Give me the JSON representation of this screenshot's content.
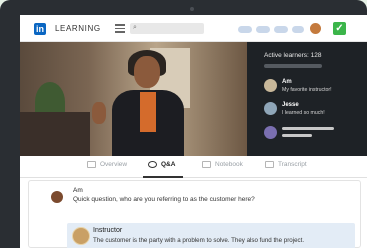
{
  "header": {
    "logo": "in",
    "brand": "LEARNING",
    "search_icon": "search-icon",
    "colors": {
      "brand": "#0a66c2",
      "check": "#3bb54a"
    }
  },
  "video": {
    "progress_fraction": 0.46
  },
  "sidebar": {
    "active_learners": "Active learners: 128",
    "messages": [
      {
        "name": "Am",
        "text": "My favorite instructor!"
      },
      {
        "name": "Jesse",
        "text": "I learned so much!"
      }
    ]
  },
  "tabs": [
    {
      "label": "Overview",
      "icon": "document-icon",
      "active": false
    },
    {
      "label": "Q&A",
      "icon": "chat-icon",
      "active": true
    },
    {
      "label": "Notebook",
      "icon": "notebook-icon",
      "active": false
    },
    {
      "label": "Transcript",
      "icon": "transcript-icon",
      "active": false
    }
  ],
  "qa": {
    "question": {
      "name": "Am",
      "text": "Quick question, who are you referring to as the customer here?"
    },
    "answer": {
      "name": "Instructor",
      "text": "The customer is the party with a problem to solve. They also fund the project."
    }
  }
}
